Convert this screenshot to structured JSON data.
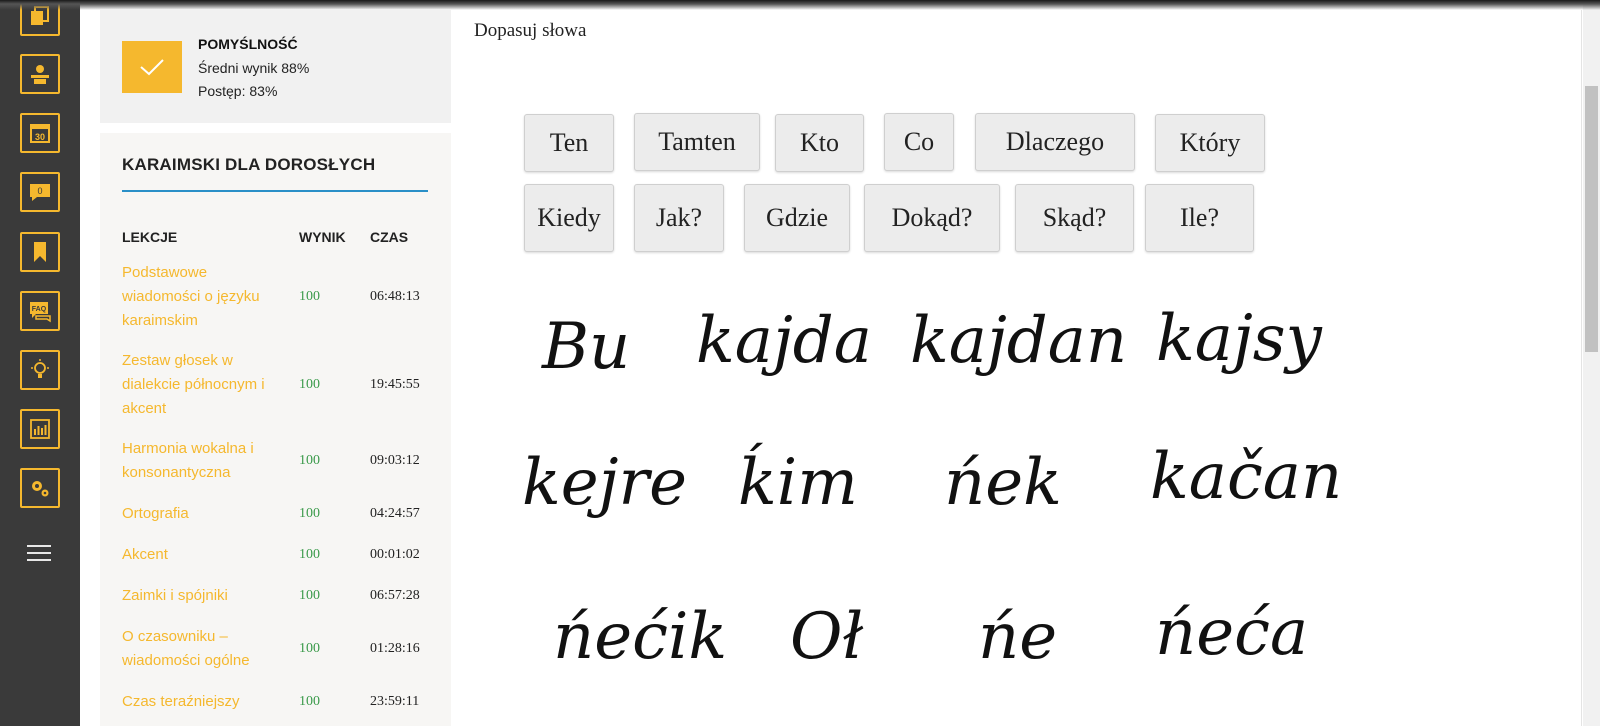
{
  "rail": {
    "items": [
      {
        "icon": "copy-icon"
      },
      {
        "icon": "users-icon"
      },
      {
        "icon": "calendar-icon",
        "badge": "30"
      },
      {
        "icon": "chat-icon",
        "badge": "0"
      },
      {
        "icon": "bookmark-icon"
      },
      {
        "icon": "faq-icon",
        "badge": "FAQ"
      },
      {
        "icon": "lightbulb-icon"
      },
      {
        "icon": "chart-icon"
      },
      {
        "icon": "settings-icon"
      }
    ],
    "accent": "#f5b82e",
    "background": "#3a3a3a"
  },
  "summary": {
    "title": "POMYŚLNOŚĆ",
    "average": "Średni wynik 88%",
    "progress": "Postęp: 83%"
  },
  "course": {
    "title": "KARAIMSKI DLA DOROSŁYCH",
    "headers": {
      "lessons": "LEKCJE",
      "score": "WYNIK",
      "time": "CZAS"
    },
    "lessons": [
      {
        "name": "Podstawowe wiadomości o języku karaimskim",
        "score": "100",
        "time": "06:48:13"
      },
      {
        "name": "Zestaw głosek w dialekcie północnym i akcent",
        "score": "100",
        "time": "19:45:55"
      },
      {
        "name": "Harmonia wokalna i konsonantyczna",
        "score": "100",
        "time": "09:03:12"
      },
      {
        "name": "Ortografia",
        "score": "100",
        "time": "04:24:57"
      },
      {
        "name": "Akcent",
        "score": "100",
        "time": "00:01:02"
      },
      {
        "name": "Zaimki i spójniki",
        "score": "100",
        "time": "06:57:28"
      },
      {
        "name": "O czasowniku – wiadomości ogólne",
        "score": "100",
        "time": "01:28:16"
      },
      {
        "name": "Czas teraźniejszy",
        "score": "100",
        "time": "23:59:11"
      }
    ]
  },
  "exercise": {
    "title": "Dopasuj słowa",
    "options": [
      "Ten",
      "Tamten",
      "Kto",
      "Co",
      "Dlaczego",
      "Który",
      "Kiedy",
      "Jak?",
      "Gdzie",
      "Dokąd?",
      "Skąd?",
      "Ile?"
    ],
    "words": [
      "Bu",
      "kajda",
      "kajdan",
      "kajsy",
      "kejre",
      "ḱim",
      "ńek",
      "kačan",
      "ńećik",
      "Oł",
      "ńe",
      "ńeća"
    ]
  }
}
